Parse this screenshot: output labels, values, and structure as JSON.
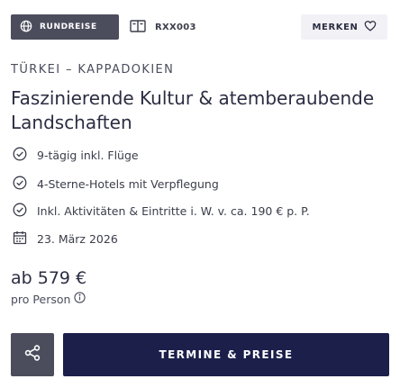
{
  "tags": {
    "type_badge": "RUNDREISE",
    "trip_code": "RXX003",
    "save_label": "MERKEN"
  },
  "trip": {
    "region": "TÜRKEI – KAPPADOKIEN",
    "title": "Faszinierende Kultur & atemberaubende Landschaften",
    "features": [
      "9-tägig inkl. Flüge",
      "4-Sterne-Hotels mit Verpflegung",
      "Inkl. Aktivitäten & Eintritte i. W. v. ca. 190 € p. P."
    ],
    "date": "23. März 2026"
  },
  "pricing": {
    "price": "ab 579 €",
    "per_person": "pro Person"
  },
  "actions": {
    "cta_label": "TERMINE & PREISE"
  },
  "icons": {
    "badge": "globe-icon",
    "code": "book-icon",
    "save": "heart-icon",
    "feature": "check-circle-icon",
    "date": "calendar-icon",
    "info": "info-icon",
    "share": "share-icon"
  },
  "colors": {
    "badge_bg": "#4b4d5c",
    "cta_bg": "#1b1f4a",
    "save_bg": "#f2f1f6",
    "text": "#2b2d42"
  }
}
